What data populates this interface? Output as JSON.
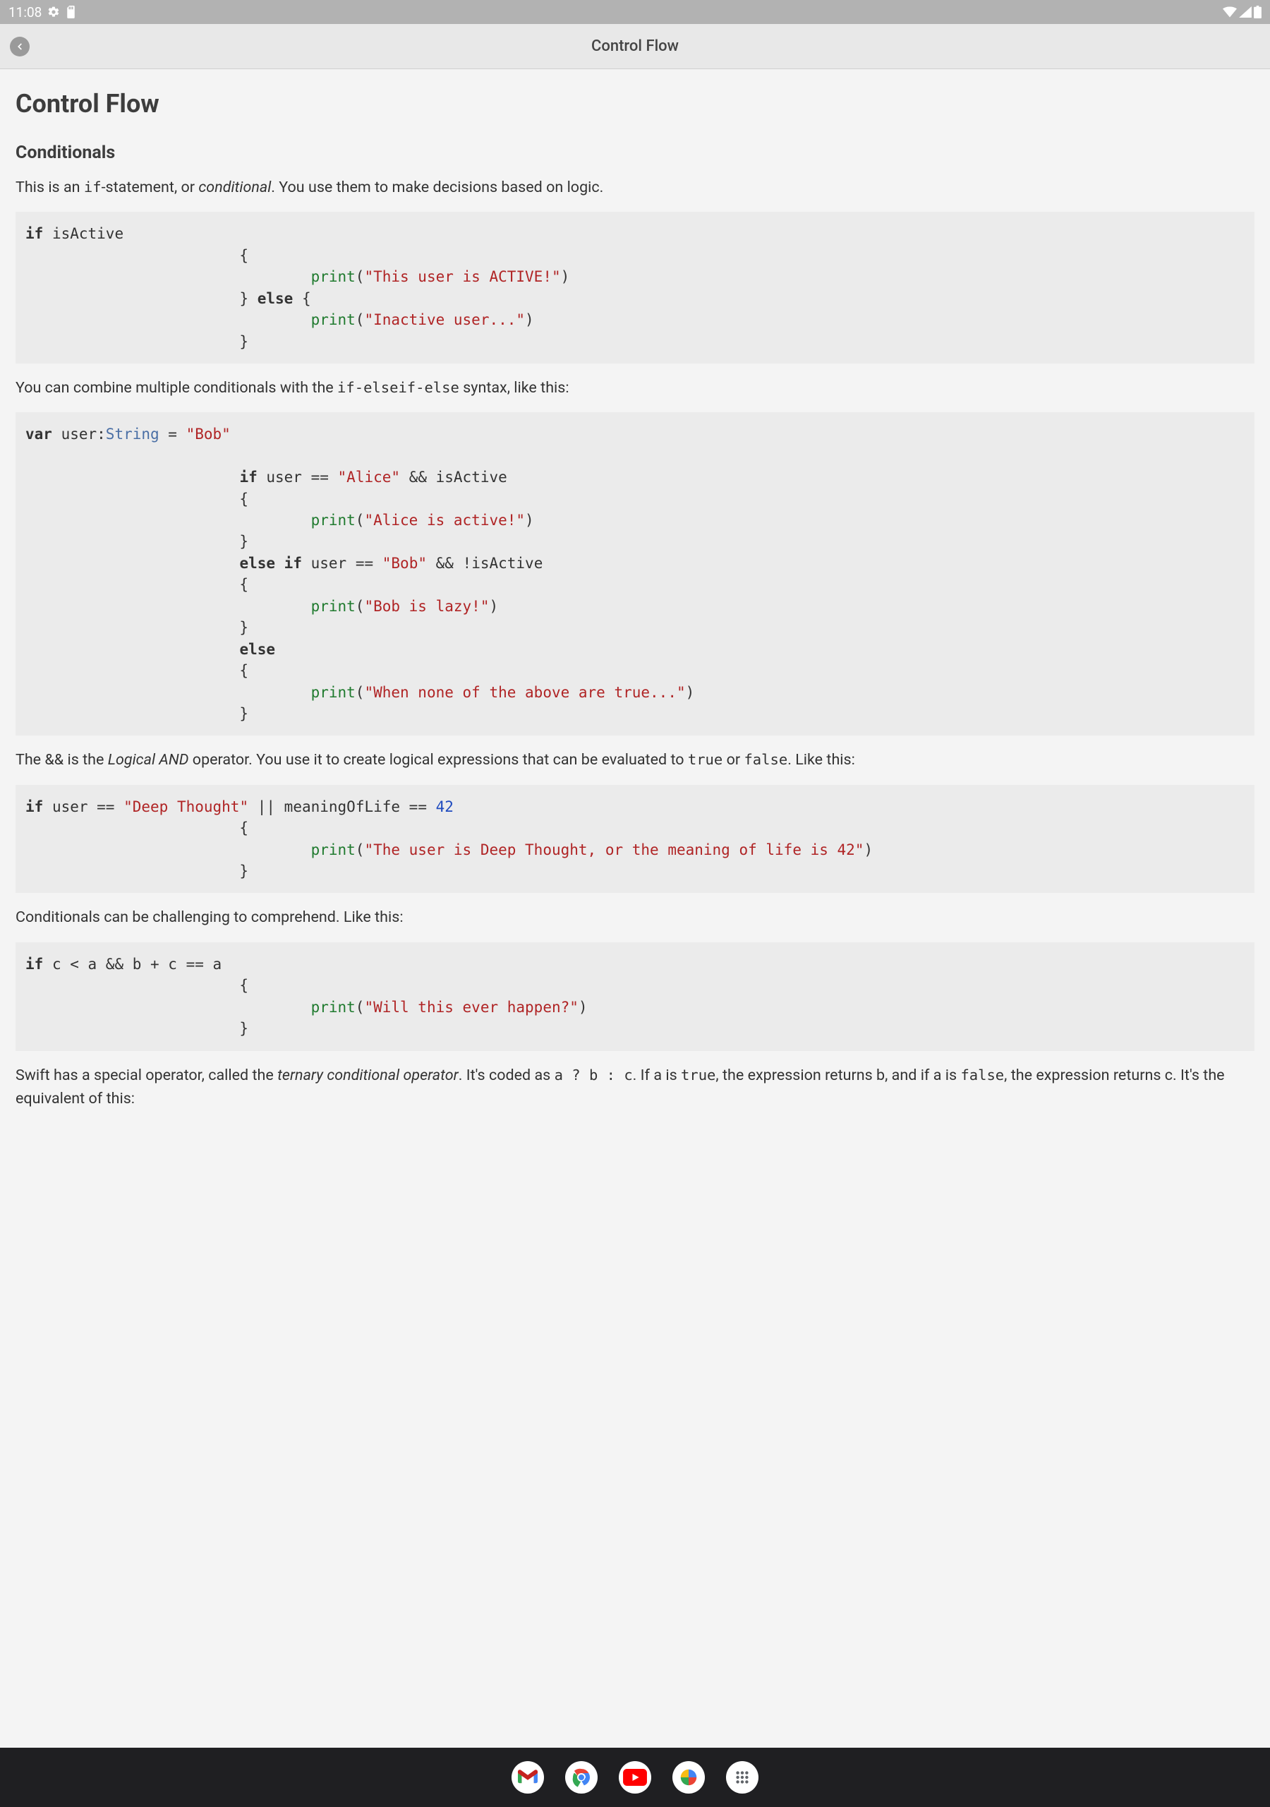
{
  "statusbar": {
    "time": "11:08"
  },
  "titlebar": {
    "title": "Control Flow"
  },
  "page": {
    "h1": "Control Flow",
    "h2_conditionals": "Conditionals",
    "p1_a": "This is an ",
    "p1_code": "if",
    "p1_b": "-statement, or ",
    "p1_em": "conditional",
    "p1_c": ". You use them to make decisions based on logic.",
    "p2_a": "You can combine multiple conditionals with the ",
    "p2_code": "if-elseif-else",
    "p2_b": " syntax, like this:",
    "p3_a": "The && is the ",
    "p3_em": "Logical AND",
    "p3_b": " operator. You use it to create logical expressions that can be evaluated to ",
    "p3_code1": "true",
    "p3_c": " or ",
    "p3_code2": "false",
    "p3_d": ". Like this:",
    "p4": "Conditionals can be challenging to comprehend. Like this:",
    "p5_a": "Swift has a special operator, called the ",
    "p5_em": "ternary conditional operator",
    "p5_b": ". It's coded as ",
    "p5_code1": "a ? b : c",
    "p5_c": ". If a is ",
    "p5_code2": "true",
    "p5_d": ", the expression returns b, and if a is ",
    "p5_code3": "false",
    "p5_e": ", the expression returns c. It's the equivalent of this:"
  },
  "code1": {
    "kw_if": "if",
    "id_isActive": " isActive",
    "l2": "                        {",
    "l3_indent": "                                ",
    "l3_fn": "print",
    "l3_p": "(",
    "l3_str": "\"This user is ACTIVE!\"",
    "l3_cp": ")",
    "l4_indent": "                        ",
    "l4_cb": "}",
    "l4_sp": " ",
    "l4_else": "else",
    "l4_ob": " {",
    "l5_indent": "                                ",
    "l5_fn": "print",
    "l5_p": "(",
    "l5_str": "\"Inactive user...\"",
    "l5_cp": ")",
    "l6": "                        }"
  },
  "code2": {
    "l1_var": "var",
    "l1_decl": " user:",
    "l1_type": "String",
    "l1_eq": " = ",
    "l1_str": "\"Bob\"",
    "blank": "",
    "l3_indent": "                        ",
    "l3_if": "if",
    "l3_a": " user == ",
    "l3_str": "\"Alice\"",
    "l3_b": " && isActive",
    "l4": "                        {",
    "l5_indent": "                                ",
    "l5_fn": "print",
    "l5_p": "(",
    "l5_str": "\"Alice is active!\"",
    "l5_cp": ")",
    "l6": "                        }",
    "l7_indent": "                        ",
    "l7_else": "else",
    "l7_sp": " ",
    "l7_if": "if",
    "l7_a": " user == ",
    "l7_str": "\"Bob\"",
    "l7_b": " && !isActive",
    "l8": "                        {",
    "l9_indent": "                                ",
    "l9_fn": "print",
    "l9_p": "(",
    "l9_str": "\"Bob is lazy!\"",
    "l9_cp": ")",
    "l10": "                        }",
    "l11_indent": "                        ",
    "l11_else": "else",
    "l12": "                        {",
    "l13_indent": "                                ",
    "l13_fn": "print",
    "l13_p": "(",
    "l13_str": "\"When none of the above are true...\"",
    "l13_cp": ")",
    "l14": "                        }"
  },
  "code3": {
    "l1_if": "if",
    "l1_a": " user == ",
    "l1_str": "\"Deep Thought\"",
    "l1_b": " || meaningOfLife == ",
    "l1_num": "42",
    "l2": "                        {",
    "l3_indent": "                                ",
    "l3_fn": "print",
    "l3_p": "(",
    "l3_str": "\"The user is Deep Thought, or the meaning of life is 42\"",
    "l3_cp": ")",
    "l4": "                        }"
  },
  "code4": {
    "l1_if": "if",
    "l1_rest": " c < a && b + c == a",
    "l2": "                        {",
    "l3_indent": "                                ",
    "l3_fn": "print",
    "l3_p": "(",
    "l3_str": "\"Will this ever happen?\"",
    "l3_cp": ")",
    "l4": "                        }"
  }
}
